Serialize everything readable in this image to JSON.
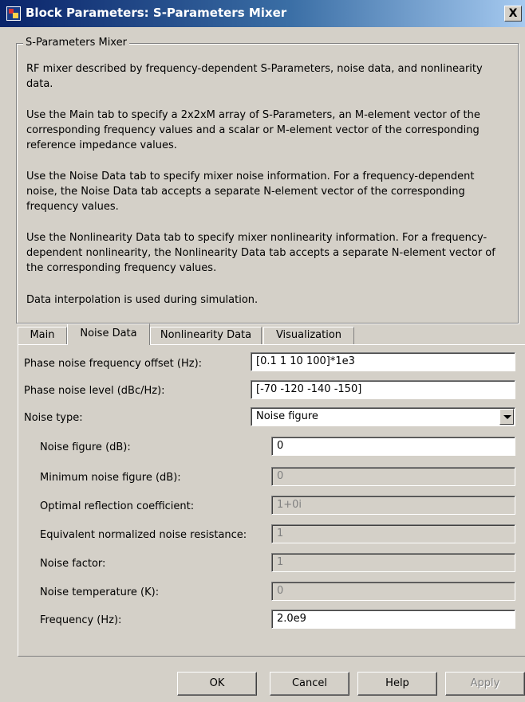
{
  "window": {
    "title": "Block Parameters: S-Parameters Mixer",
    "close_label": "X"
  },
  "group": {
    "legend": "S-Parameters Mixer",
    "paragraphs": [
      "RF mixer described by frequency-dependent S-Parameters, noise data, and nonlinearity data.",
      "Use the Main tab to specify a 2x2xM array of S-Parameters, an M-element vector of the corresponding frequency values and a scalar or M-element vector of the corresponding reference impedance values.",
      "Use the Noise Data tab to specify mixer noise information. For a frequency-dependent noise, the Noise Data tab accepts a separate N-element vector of the corresponding frequency values.",
      "Use the Nonlinearity Data tab to specify mixer nonlinearity information. For a frequency-dependent nonlinearity, the Nonlinearity Data tab accepts a separate N-element vector of the corresponding frequency values.",
      "Data interpolation is used during simulation."
    ]
  },
  "tabs": [
    {
      "label": "Main"
    },
    {
      "label": "Noise Data",
      "active": true
    },
    {
      "label": "Nonlinearity Data"
    },
    {
      "label": "Visualization"
    }
  ],
  "noise": {
    "phase_offset": {
      "label": "Phase noise frequency offset (Hz):",
      "value": "[0.1 1 10 100]*1e3"
    },
    "phase_level": {
      "label": "Phase noise level (dBc/Hz):",
      "value": "[-70 -120 -140 -150]"
    },
    "noise_type": {
      "label": "Noise type:",
      "value": "Noise figure"
    },
    "noise_figure": {
      "label": "Noise figure (dB):",
      "value": "0"
    },
    "min_noise_figure": {
      "label": "Minimum noise figure (dB):",
      "value": "0"
    },
    "opt_reflection": {
      "label": "Optimal reflection coefficient:",
      "value": "1+0i"
    },
    "eq_resistance": {
      "label": "Equivalent normalized noise resistance:",
      "value": "1"
    },
    "noise_factor": {
      "label": "Noise factor:",
      "value": "1"
    },
    "noise_temp": {
      "label": "Noise temperature (K):",
      "value": "0"
    },
    "frequency": {
      "label": "Frequency (Hz):",
      "value": "2.0e9"
    }
  },
  "buttons": {
    "ok": "OK",
    "cancel": "Cancel",
    "help": "Help",
    "apply": "Apply"
  }
}
